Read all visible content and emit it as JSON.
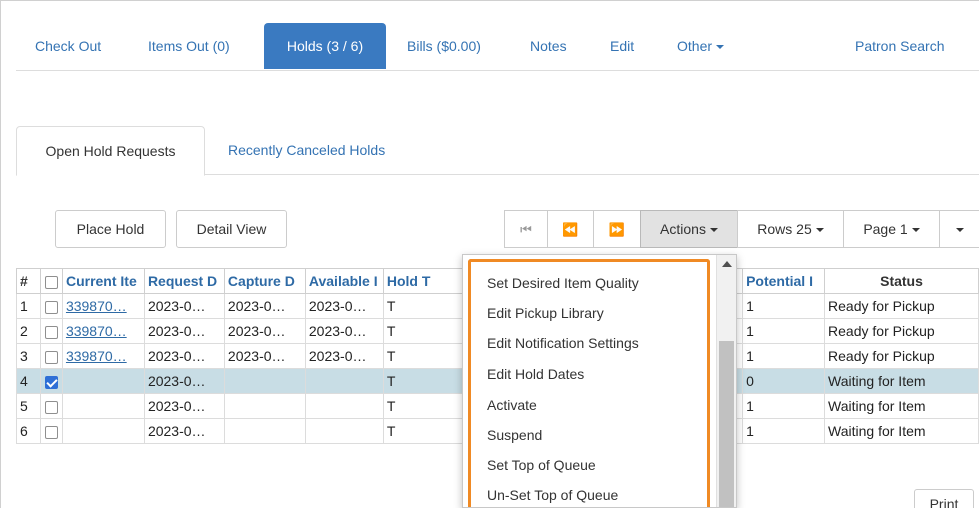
{
  "topnav": {
    "check_out": "Check Out",
    "items_out": "Items Out (0)",
    "holds": "Holds (3 / 6)",
    "bills": "Bills ($0.00)",
    "notes": "Notes",
    "edit": "Edit",
    "other": "Other",
    "patron_search": "Patron Search"
  },
  "subtabs": {
    "open": "Open Hold Requests",
    "canceled": "Recently Canceled Holds"
  },
  "toolbar": {
    "place_hold": "Place Hold",
    "detail_view": "Detail View",
    "first_icon": "first-page-icon",
    "prev_icon": "previous-page-icon",
    "next_icon": "next-page-icon",
    "actions": "Actions",
    "rows": "Rows 25",
    "page": "Page 1"
  },
  "table": {
    "headers": {
      "num": "#",
      "current_item": "Current Ite",
      "request_date": "Request D",
      "capture_date": "Capture D",
      "available": "Available I",
      "hold_type": "Hold T",
      "potential": "Potential I",
      "status": "Status"
    },
    "rows": [
      {
        "num": "1",
        "checked": false,
        "item": "339870…",
        "request": "2023-0…",
        "capture": "2023-0…",
        "available": "2023-0…",
        "type": "T",
        "potential": "1",
        "status": "Ready for Pickup"
      },
      {
        "num": "2",
        "checked": false,
        "item": "339870…",
        "request": "2023-0…",
        "capture": "2023-0…",
        "available": "2023-0…",
        "type": "T",
        "potential": "1",
        "status": "Ready for Pickup"
      },
      {
        "num": "3",
        "checked": false,
        "item": "339870…",
        "request": "2023-0…",
        "capture": "2023-0…",
        "available": "2023-0…",
        "type": "T",
        "potential": "1",
        "status": "Ready for Pickup"
      },
      {
        "num": "4",
        "checked": true,
        "item": "",
        "request": "2023-0…",
        "capture": "",
        "available": "",
        "type": "T",
        "potential": "0",
        "status": "Waiting for Item"
      },
      {
        "num": "5",
        "checked": false,
        "item": "",
        "request": "2023-0…",
        "capture": "",
        "available": "",
        "type": "T",
        "potential": "1",
        "status": "Waiting for Item"
      },
      {
        "num": "6",
        "checked": false,
        "item": "",
        "request": "2023-0…",
        "capture": "",
        "available": "",
        "type": "T",
        "potential": "1",
        "status": "Waiting for Item"
      }
    ]
  },
  "menu": {
    "items": [
      "Set Desired Item Quality",
      "Edit Pickup Library",
      "Edit Notification Settings",
      "Edit Hold Dates",
      "Activate",
      "Suspend",
      "Set Top of Queue",
      "Un-Set Top of Queue"
    ],
    "highlight_color": "#f08a24"
  },
  "footer": {
    "print": "Print"
  },
  "colors": {
    "accent": "#3a7ac1",
    "link": "#3473b3",
    "selected_row": "#c8dde5"
  }
}
